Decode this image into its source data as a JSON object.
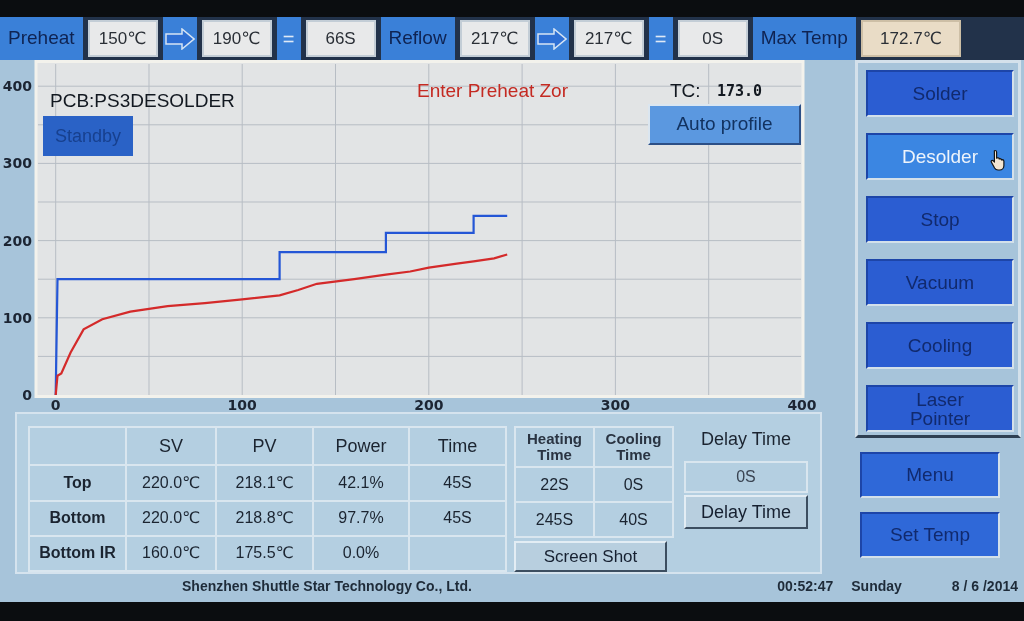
{
  "top_bar": [
    {
      "kind": "label",
      "text": "Preheat"
    },
    {
      "kind": "field",
      "text": "150℃"
    },
    {
      "kind": "arrow"
    },
    {
      "kind": "field",
      "text": "190℃"
    },
    {
      "kind": "sign",
      "text": "="
    },
    {
      "kind": "field",
      "text": "66S"
    },
    {
      "kind": "label",
      "text": "Reflow"
    },
    {
      "kind": "field",
      "text": "217℃"
    },
    {
      "kind": "arrow"
    },
    {
      "kind": "field",
      "text": "217℃"
    },
    {
      "kind": "sign",
      "text": "="
    },
    {
      "kind": "field",
      "text": "0S"
    },
    {
      "kind": "label",
      "text": "Max Temp"
    },
    {
      "kind": "reading",
      "text": "172.7℃"
    }
  ],
  "chart_panel": {
    "pcb": "PCB:PS3DESOLDER",
    "status_button": "Standby",
    "message": "Enter Preheat Zor",
    "tc_label": "TC:",
    "tc_value": "173.0",
    "auto_button": "Auto profile",
    "chart_data": {
      "type": "line",
      "x": [
        0,
        1,
        3,
        8,
        15,
        25,
        40,
        60,
        80,
        100,
        120,
        120,
        130,
        140,
        160,
        177,
        177,
        190,
        200,
        215,
        224,
        224,
        235,
        242
      ],
      "series": [
        {
          "color": "#2456d6",
          "values": [
            0,
            150,
            150,
            150,
            150,
            150,
            150,
            150,
            150,
            150,
            150,
            185,
            185,
            185,
            185,
            185,
            210,
            210,
            210,
            210,
            210,
            232,
            232,
            232
          ]
        },
        {
          "color": "#d42a2a",
          "values": [
            0,
            25,
            28,
            55,
            85,
            98,
            108,
            115,
            119,
            124,
            129,
            129,
            136,
            144,
            150,
            156,
            156,
            160,
            165,
            170,
            173,
            173,
            177,
            182
          ]
        }
      ],
      "xlim": [
        -10,
        400
      ],
      "ylim": [
        0,
        430
      ],
      "xticks": [
        0,
        100,
        200,
        300,
        400
      ],
      "yticks": [
        0,
        100,
        200,
        300,
        400
      ],
      "grid": true
    }
  },
  "mode_buttons": [
    {
      "label": "Solder",
      "selected": false
    },
    {
      "label": "Desolder",
      "selected": true
    },
    {
      "label": "Stop",
      "selected": false
    },
    {
      "label": "Vacuum",
      "selected": false
    },
    {
      "label": "Cooling",
      "selected": false
    },
    {
      "label": "Laser Pointer",
      "selected": false
    }
  ],
  "menu_buttons": [
    "Menu",
    "Set Temp"
  ],
  "table": {
    "columns": [
      "SV",
      "PV",
      "Power",
      "Time"
    ],
    "rows": [
      {
        "label": "Top",
        "cells": [
          "220.0℃",
          "218.1℃",
          "42.1%",
          "45S"
        ]
      },
      {
        "label": "Bottom",
        "cells": [
          "220.0℃",
          "218.8℃",
          "97.7%",
          "45S"
        ]
      },
      {
        "label": "Bottom IR",
        "cells": [
          "160.0℃",
          "175.5℃",
          "0.0%"
        ]
      }
    ]
  },
  "timers": {
    "columns": [
      "Heating Time",
      "Cooling Time"
    ],
    "rows": [
      [
        "22S",
        "0S"
      ],
      [
        "245S",
        "40S"
      ]
    ]
  },
  "screen_shot_button": "Screen Shot",
  "delay": {
    "label": "Delay Time",
    "value": "0S",
    "button": "Delay Time"
  },
  "status_bar": {
    "company": "Shenzhen Shuttle Star Technology Co., Ltd.",
    "time": "00:52:47",
    "day": "Sunday",
    "date": "8 / 6 /2014"
  }
}
